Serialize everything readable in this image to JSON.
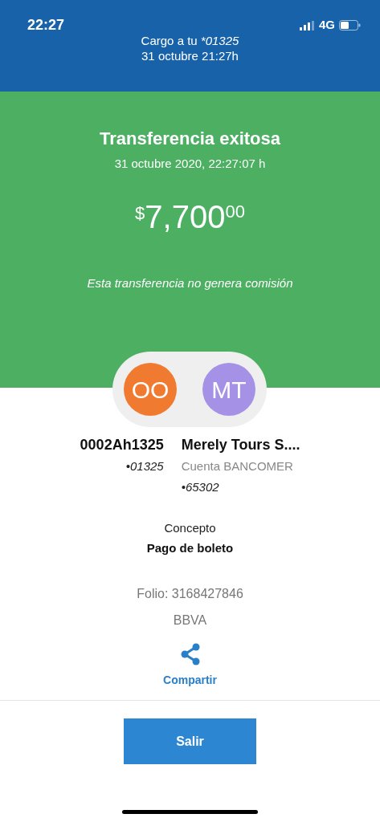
{
  "status_bar": {
    "time": "22:27",
    "network": "4G"
  },
  "header": {
    "label": "Cargo a tu",
    "account": "*01325",
    "date": "31 octubre 21:27h"
  },
  "result": {
    "title": "Transferencia exitosa",
    "datetime": "31 octubre 2020, 22:27:07 h",
    "amount": {
      "currency": "$",
      "whole": "7,700",
      "cents": "00"
    },
    "note": "Esta transferencia no genera comisión"
  },
  "parties": [
    {
      "initials": "OO",
      "color": "#f07a30",
      "name": "0002Ah1325",
      "lines": [
        {
          "text": "•01325",
          "italic": true
        }
      ]
    },
    {
      "initials": "MT",
      "color": "#a592e6",
      "name": "Merely Tours S....",
      "lines": [
        {
          "text": "Cuenta BANCOMER",
          "italic": false
        },
        {
          "text": "•65302",
          "italic": true
        }
      ]
    }
  ],
  "concept": {
    "label": "Concepto",
    "value": "Pago de boleto"
  },
  "folio": "Folio: 3168427846",
  "bank": "BBVA",
  "share": {
    "label": "Compartir"
  },
  "exit_button": {
    "label": "Salir"
  }
}
